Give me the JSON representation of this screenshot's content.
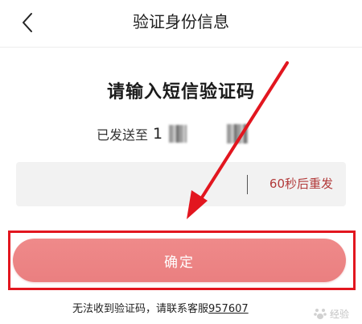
{
  "header": {
    "title": "验证身份信息",
    "back_icon": "chevron-left-icon"
  },
  "main": {
    "headline": "请输入短信验证码",
    "sent_label": "已发送至",
    "phone_visible": "1",
    "code_input": {
      "value": "",
      "placeholder": ""
    },
    "resend_countdown": "60秒后重发",
    "confirm_label": "确定",
    "footer_text": "无法收到验证码，请联系客服",
    "service_number": "957607"
  },
  "watermark": {
    "text": "经验"
  },
  "colors": {
    "accent": "#ea7f80",
    "countdown": "#b23a3a",
    "highlight": "#e2161f"
  }
}
